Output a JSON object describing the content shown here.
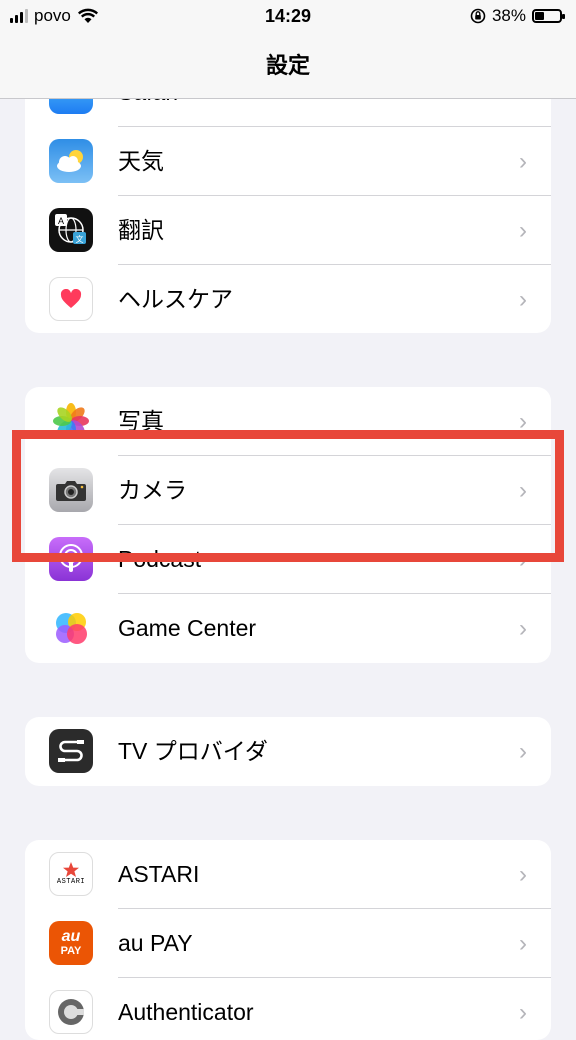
{
  "status_bar": {
    "carrier": "povo",
    "time": "14:29",
    "battery": "38%",
    "battery_level": 0.38
  },
  "nav": {
    "title": "設定"
  },
  "group1": {
    "partial_label": "Safari",
    "rows": [
      {
        "label": "天気",
        "icon": "weather-icon"
      },
      {
        "label": "翻訳",
        "icon": "translate-icon"
      },
      {
        "label": "ヘルスケア",
        "icon": "health-icon"
      }
    ]
  },
  "group2": {
    "rows": [
      {
        "label": "写真",
        "icon": "photos-icon"
      },
      {
        "label": "カメラ",
        "icon": "camera-icon"
      },
      {
        "label": "Podcast",
        "icon": "podcast-icon"
      },
      {
        "label": "Game Center",
        "icon": "game-center-icon"
      }
    ]
  },
  "group3": {
    "rows": [
      {
        "label": "TV プロバイダ",
        "icon": "tv-provider-icon"
      }
    ]
  },
  "group4": {
    "rows": [
      {
        "label": "ASTARI",
        "icon": "astari-icon",
        "icon_text": "ASTARI"
      },
      {
        "label": "au PAY",
        "icon": "aupay-icon",
        "icon_top": "au",
        "icon_bottom": "PAY"
      },
      {
        "label": "Authenticator",
        "icon": "authenticator-icon"
      }
    ]
  },
  "chevron": "›",
  "colors": {
    "highlight": "#e8473a",
    "chevron": "#b5b5ba",
    "background": "#f2f2f7"
  }
}
